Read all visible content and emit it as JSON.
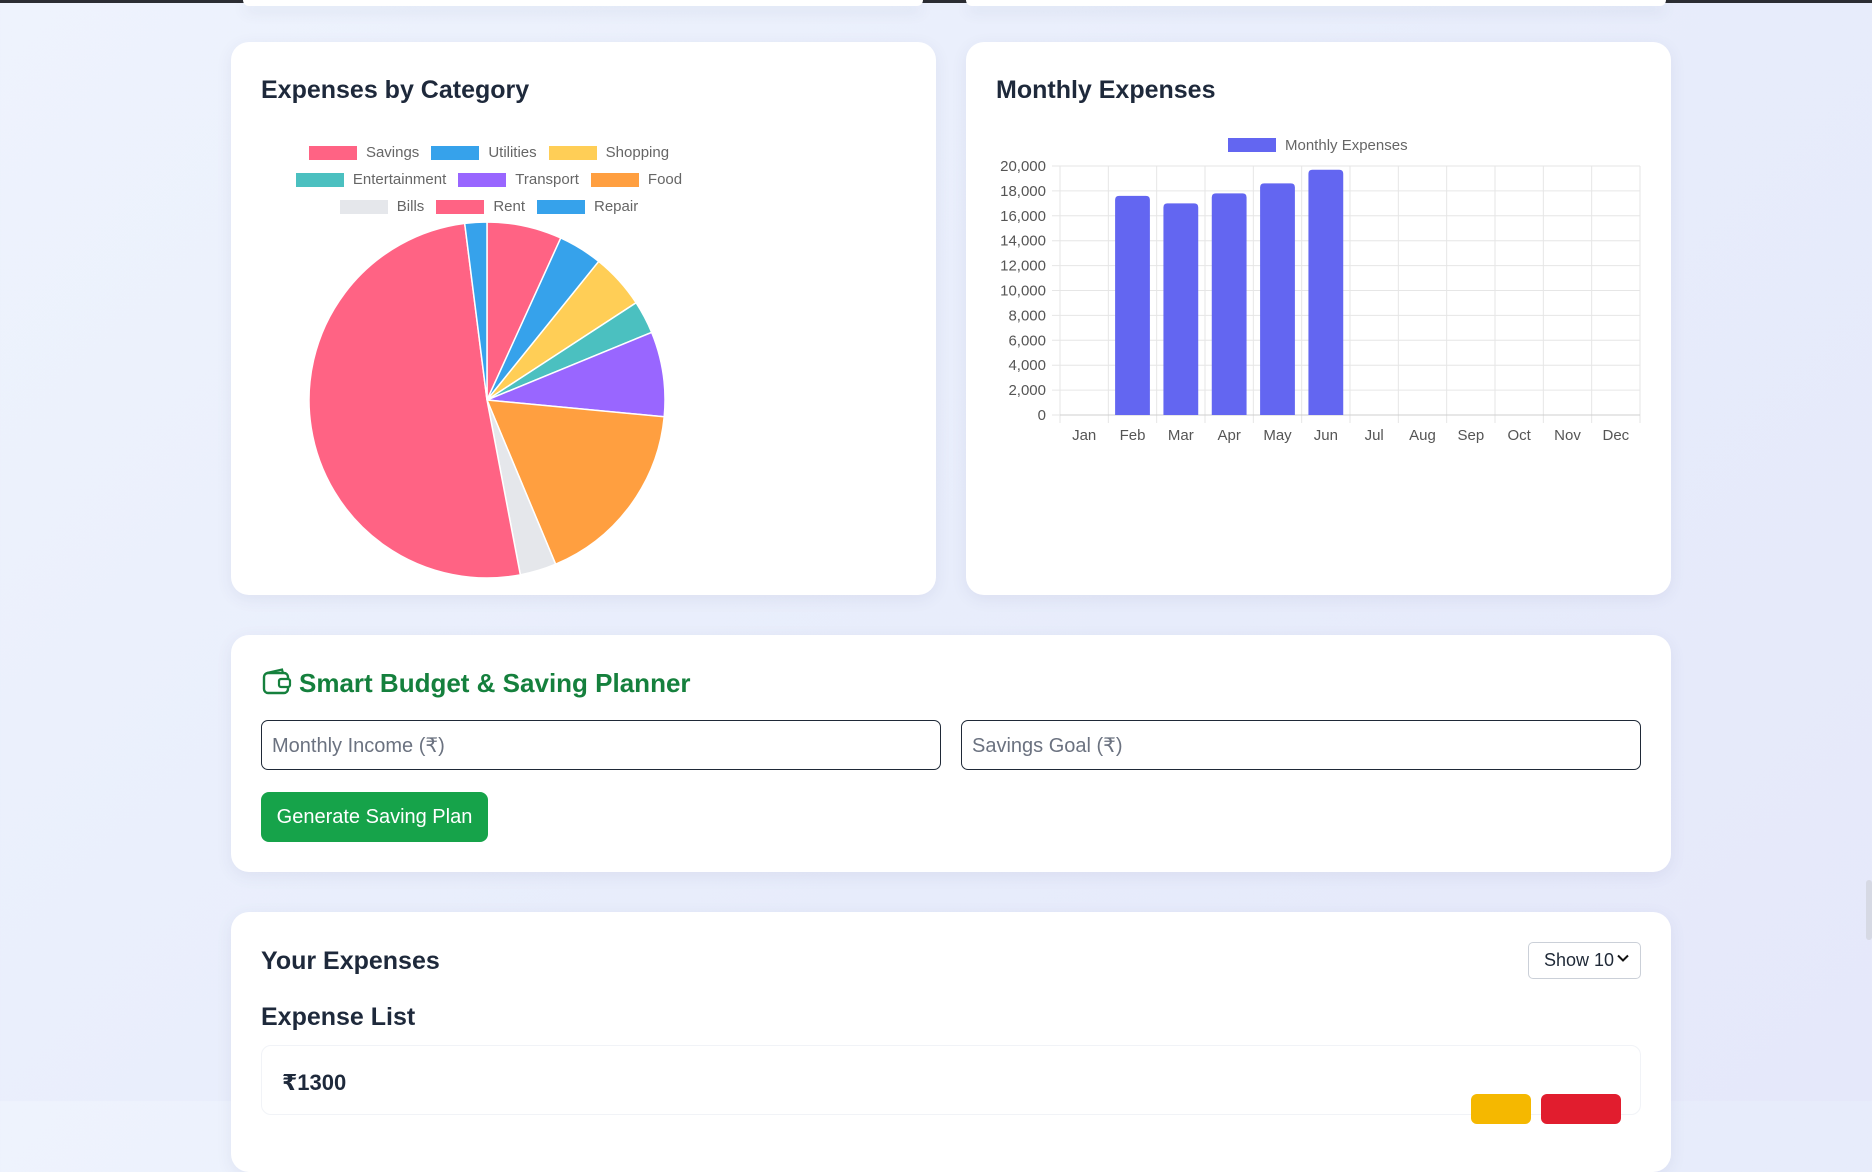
{
  "category_card": {
    "title": "Expenses by Category"
  },
  "monthly_card": {
    "title": "Monthly Expenses"
  },
  "planner": {
    "title": "Smart Budget & Saving Planner",
    "income_placeholder": "Monthly Income (₹)",
    "goal_placeholder": "Savings Goal (₹)",
    "generate_label": "Generate Saving Plan",
    "accent_color": "#15803d",
    "button_color": "#16a34a"
  },
  "expenses": {
    "title": "Your Expenses",
    "show_select": "Show 10",
    "list_title": "Expense List",
    "items": [
      {
        "amount": "₹1300"
      }
    ],
    "edit_color": "#f5b800",
    "delete_color": "#e11d2e"
  },
  "chart_data": [
    {
      "type": "pie",
      "title": "",
      "legend_placement": "top",
      "legend": [
        "Savings",
        "Utilities",
        "Shopping",
        "Entertainment",
        "Transport",
        "Food",
        "Bills",
        "Rent",
        "Repair"
      ],
      "values": [
        6.8,
        4.0,
        5.0,
        3.0,
        7.7,
        17.2,
        3.3,
        51.0,
        2.0
      ],
      "colors": [
        "#ff6384",
        "#36a2eb",
        "#ffce56",
        "#4bc0c0",
        "#9966ff",
        "#ff9f40",
        "#e5e7eb",
        "#ff6384",
        "#36a2eb"
      ]
    },
    {
      "type": "bar",
      "title": "",
      "legend_placement": "top",
      "categories": [
        "Jan",
        "Feb",
        "Mar",
        "Apr",
        "May",
        "Jun",
        "Jul",
        "Aug",
        "Sep",
        "Oct",
        "Nov",
        "Dec"
      ],
      "series": [
        {
          "name": "Monthly Expenses",
          "color": "#6366f1",
          "values": [
            0,
            17600,
            17000,
            17800,
            18600,
            19700,
            0,
            0,
            0,
            0,
            0,
            0
          ]
        }
      ],
      "ylim": [
        0,
        20000
      ],
      "yticks": [
        "20,000",
        "18,000",
        "16,000",
        "14,000",
        "12,000",
        "10,000",
        "8,000",
        "6,000",
        "4,000",
        "2,000",
        "0"
      ],
      "grid": true
    }
  ]
}
